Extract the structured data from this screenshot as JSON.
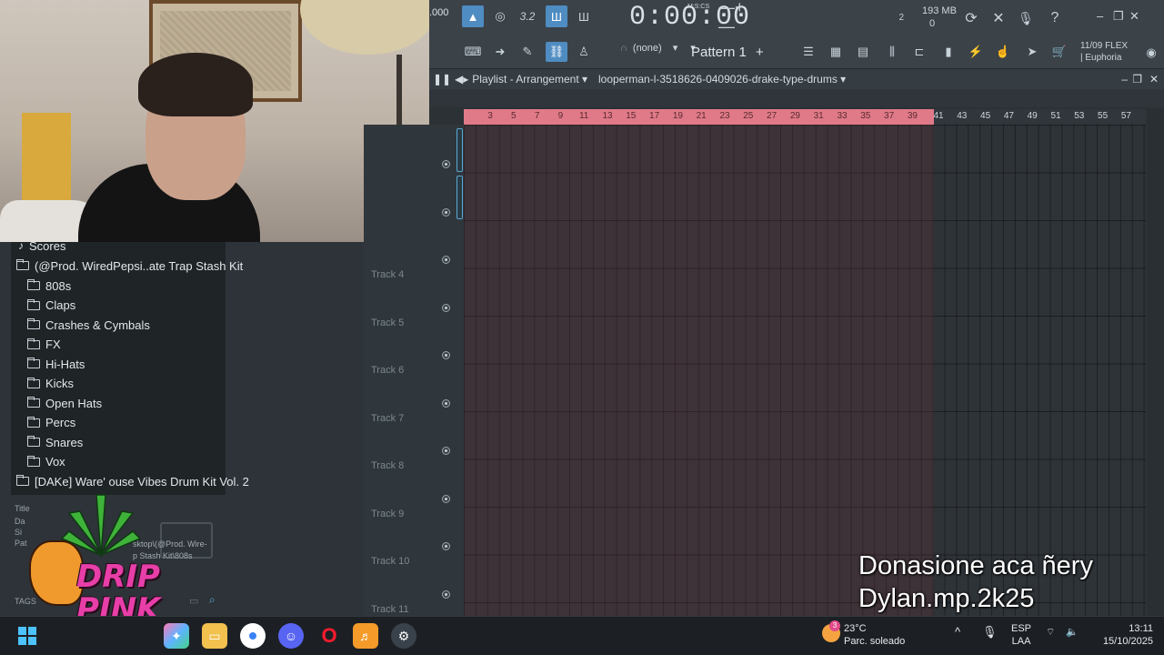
{
  "toolbar": {
    "tempo_partial": ".000",
    "time": "0:00:00",
    "time_units": "M:S:CS",
    "mem_value": "193 MB",
    "mem_sub": "0",
    "cpu_value": "2",
    "pattern": "Pattern 1",
    "channel_none": "(none)",
    "flex_date": "11/09",
    "flex_label": "FLEX",
    "flex_preset": "| Euphoria"
  },
  "playlist": {
    "title": "Playlist - Arrangement",
    "pattern_name": "looperman-l-3518626-0409026-drake-type-drums",
    "ruler_ticks_loop": [
      "3",
      "5",
      "7",
      "9",
      "11",
      "13",
      "15",
      "17",
      "19",
      "21",
      "23",
      "25",
      "27",
      "29",
      "31",
      "33",
      "35",
      "37",
      "39"
    ],
    "ruler_ticks_after": [
      "41",
      "43",
      "45",
      "47",
      "49",
      "51",
      "53",
      "55",
      "57"
    ],
    "tracks": [
      "Track 4",
      "Track 5",
      "Track 6",
      "Track 7",
      "Track 8",
      "Track 9",
      "Track 10",
      "Track 11"
    ]
  },
  "browser": {
    "scores_label": "Scores",
    "kit1": "(@Prod. WiredPepsi..ate Trap Stash Kit",
    "folders": [
      "808s",
      "Claps",
      "Crashes & Cymbals",
      "FX",
      "Hi-Hats",
      "Kicks",
      "Open Hats",
      "Percs",
      "Snares",
      "Vox"
    ],
    "kit2": "[DAKe] Ware' ouse Vibes Drum Kit Vol. 2",
    "info_labels": [
      "Title",
      "Da",
      "Si",
      "Pat"
    ],
    "ghost_path_1": "sktop\\(@Prod. Wire-",
    "ghost_path_2": "p Stash Kit\\808s",
    "tags_label": "TAGS"
  },
  "logo": {
    "line1": "DRIP",
    "line2": "PINK"
  },
  "overlay": {
    "line1": "Donasione aca ñery",
    "line2": "Dylan.mp.2k25"
  },
  "taskbar": {
    "weather_temp": "23°C",
    "weather_desc": "Parc. soleado",
    "weather_badge": "3",
    "lang_top": "ESP",
    "lang_bottom": "LAA",
    "clock_time": "13:11",
    "clock_date": "15/10/2025"
  },
  "colors": {
    "loop_region": "#e07a88",
    "accent_blue": "#4f8cc2",
    "logo_pink": "#e83ea8"
  }
}
